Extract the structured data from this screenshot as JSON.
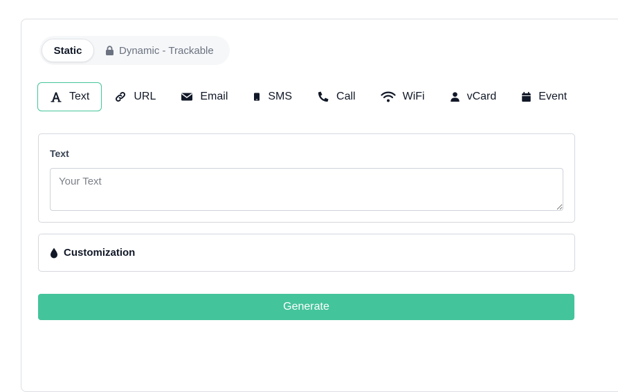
{
  "mode": {
    "static_label": "Static",
    "dynamic_label": "Dynamic - Trackable",
    "dynamic_icon": "lock-icon",
    "selected": "Static"
  },
  "tabs": [
    {
      "label": "Text",
      "icon": "text-icon",
      "active": true
    },
    {
      "label": "URL",
      "icon": "link-icon",
      "active": false
    },
    {
      "label": "Email",
      "icon": "envelope-icon",
      "active": false
    },
    {
      "label": "SMS",
      "icon": "mobile-icon",
      "active": false
    },
    {
      "label": "Call",
      "icon": "phone-icon",
      "active": false
    },
    {
      "label": "WiFi",
      "icon": "wifi-icon",
      "active": false
    },
    {
      "label": "vCard",
      "icon": "user-icon",
      "active": false
    },
    {
      "label": "Event",
      "icon": "calendar-icon",
      "active": false
    }
  ],
  "text_panel": {
    "label": "Text",
    "value": "",
    "placeholder": "Your Text"
  },
  "customization": {
    "title": "Customization",
    "icon": "droplet-icon"
  },
  "generate": {
    "label": "Generate"
  },
  "colors": {
    "accent": "#44c49b",
    "text": "#111827",
    "muted": "#6b7280",
    "border": "#d4d7dc"
  }
}
